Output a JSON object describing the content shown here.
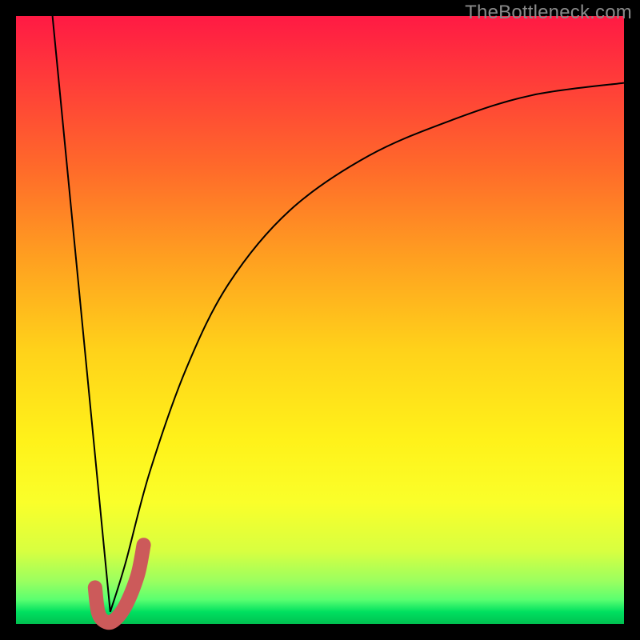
{
  "watermark": "TheBottleneck.com",
  "colors": {
    "background": "#000000",
    "gradient_top": "#ff1a44",
    "gradient_mid": "#ffd21a",
    "gradient_bottom": "#00c050",
    "curve": "#000000",
    "marker": "#cc5a5a"
  },
  "chart_data": {
    "type": "line",
    "title": "",
    "xlabel": "",
    "ylabel": "",
    "xlim": [
      0,
      100
    ],
    "ylim": [
      0,
      100
    ],
    "series": [
      {
        "name": "left-branch",
        "x": [
          6,
          15.5
        ],
        "y": [
          100,
          2
        ],
        "style": "thin-black"
      },
      {
        "name": "right-branch",
        "x": [
          15.5,
          18,
          22,
          28,
          35,
          45,
          58,
          72,
          85,
          100
        ],
        "y": [
          2,
          10,
          25,
          42,
          56,
          68,
          77,
          83,
          87,
          89
        ],
        "style": "thin-black"
      },
      {
        "name": "marker-hook",
        "x": [
          13,
          13.5,
          14.5,
          16,
          18,
          20,
          21
        ],
        "y": [
          6,
          2,
          0.5,
          0.5,
          3,
          8,
          13
        ],
        "style": "thick-red"
      }
    ],
    "annotations": []
  }
}
